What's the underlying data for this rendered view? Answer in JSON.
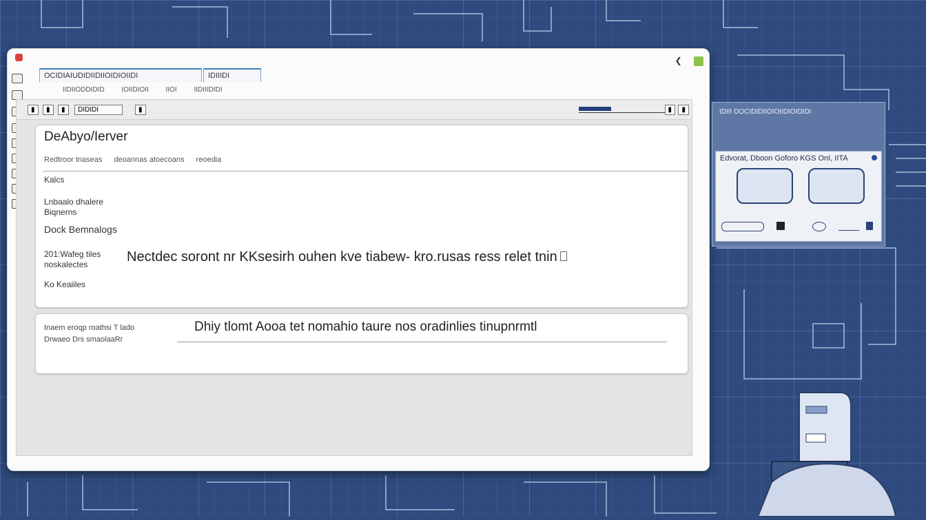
{
  "window": {
    "tabs": [
      "OCIDIAIUDIDIIDIIOIDIOIIDI",
      "IDIIIDI"
    ],
    "subtabs": [
      "IIDIIODDIDID",
      "IOIIDIOII",
      "IIOI",
      "IIDIIIDIDI"
    ],
    "toolbar": {
      "dropdown": "DIDIDI"
    }
  },
  "server": {
    "title": "DeAbyo/Ierver",
    "subrow": [
      "Redtroor tnaseas",
      "deoannas atoecoans",
      "reoedia"
    ],
    "labels": {
      "kalcs": "Kalcs",
      "line2a": "Lnbaalo dhalere",
      "line2b": "Biqnerns",
      "dock": "Dock Bemnalogs",
      "line4a": "201:Wafeg tiles",
      "line4b": "noskalectes",
      "ko": "Ko Keaiiles"
    },
    "statement": "Nectdec soront nr KKsesirh ouhen kve tiabew- kro.rusas ress relet tnin",
    "progress": 0.36
  },
  "note": {
    "label_a": "Inaem eroqp roathsi T lado",
    "label_b": "Drwaeo   Drs smaolaaRr",
    "text": "Dhiy tlomt Aooa tet nomahio taure nos oradinlies tinupnrmtl"
  },
  "side_panel": {
    "header": "IDIII  DOCIDIDIIOIOIIDIOIDIDI",
    "card_title": "Edvorat, Dboon Goforo KGS OnI, IITA"
  }
}
